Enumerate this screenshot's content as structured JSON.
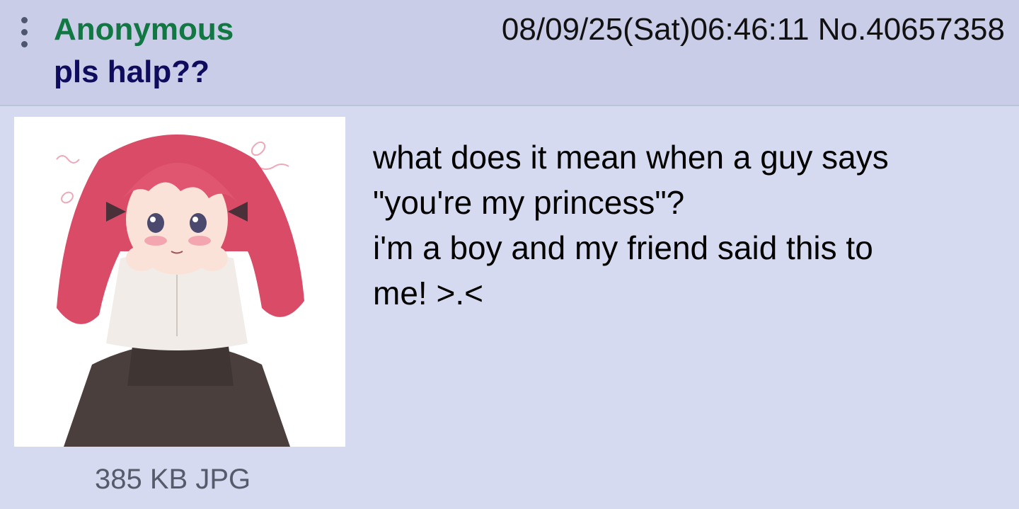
{
  "post": {
    "author": "Anonymous",
    "subject": "pls halp??",
    "datetime": "08/09/25(Sat)06:46:11",
    "post_number": "No.40657358",
    "meta_text": "08/09/25(Sat)06:46:11 No.40657358",
    "file_info": "385 KB JPG",
    "body_lines": [
      "what does it mean when a guy says",
      "\"you're my princess\"?",
      "i'm a boy and my friend said this to",
      "me! >.<"
    ]
  },
  "icons": {
    "menu": "more-vertical-icon"
  },
  "colors": {
    "page_background": "#d6daf0",
    "header_background": "#cacde8",
    "author": "#117743",
    "subject": "#0f0c5d",
    "file_info": "#555b6a"
  }
}
